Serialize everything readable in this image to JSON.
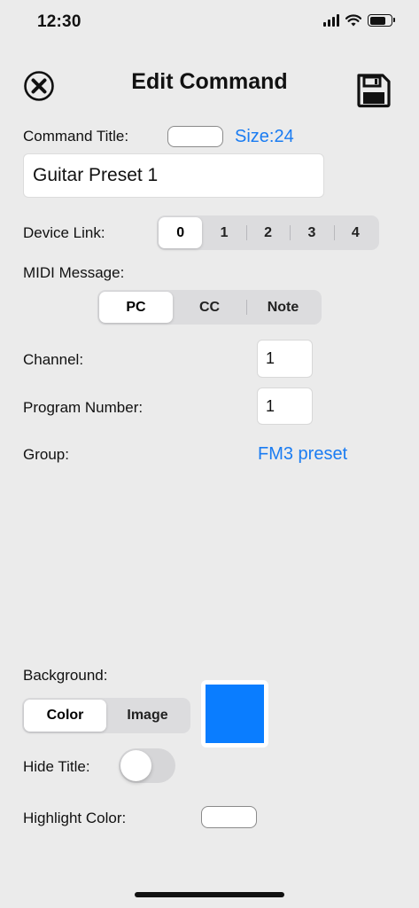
{
  "status_bar": {
    "time": "12:30"
  },
  "nav": {
    "title": "Edit Command",
    "close_icon": "close-circle-icon",
    "save_icon": "floppy-disk-icon"
  },
  "command_title": {
    "label": "Command Title:",
    "size_text": "Size:24",
    "value": "Guitar Preset 1",
    "swatch_color": "#ffffff"
  },
  "device_link": {
    "label": "Device Link:",
    "options": [
      "0",
      "1",
      "2",
      "3",
      "4"
    ],
    "selected": "0"
  },
  "midi_message": {
    "label": "MIDI Message:",
    "options": [
      "PC",
      "CC",
      "Note"
    ],
    "selected": "PC"
  },
  "channel": {
    "label": "Channel:",
    "value": "1"
  },
  "program_number": {
    "label": "Program Number:",
    "value": "1"
  },
  "group": {
    "label": "Group:",
    "value": "FM3 preset"
  },
  "background": {
    "label": "Background:",
    "options": [
      "Color",
      "Image"
    ],
    "selected": "Color",
    "color": "#0a7dff"
  },
  "hide_title": {
    "label": "Hide Title:",
    "on": false
  },
  "highlight_color": {
    "label": "Highlight Color:",
    "color": "#ffffff"
  },
  "colors": {
    "accent": "#1a7cf2",
    "background": "#ebebeb"
  }
}
